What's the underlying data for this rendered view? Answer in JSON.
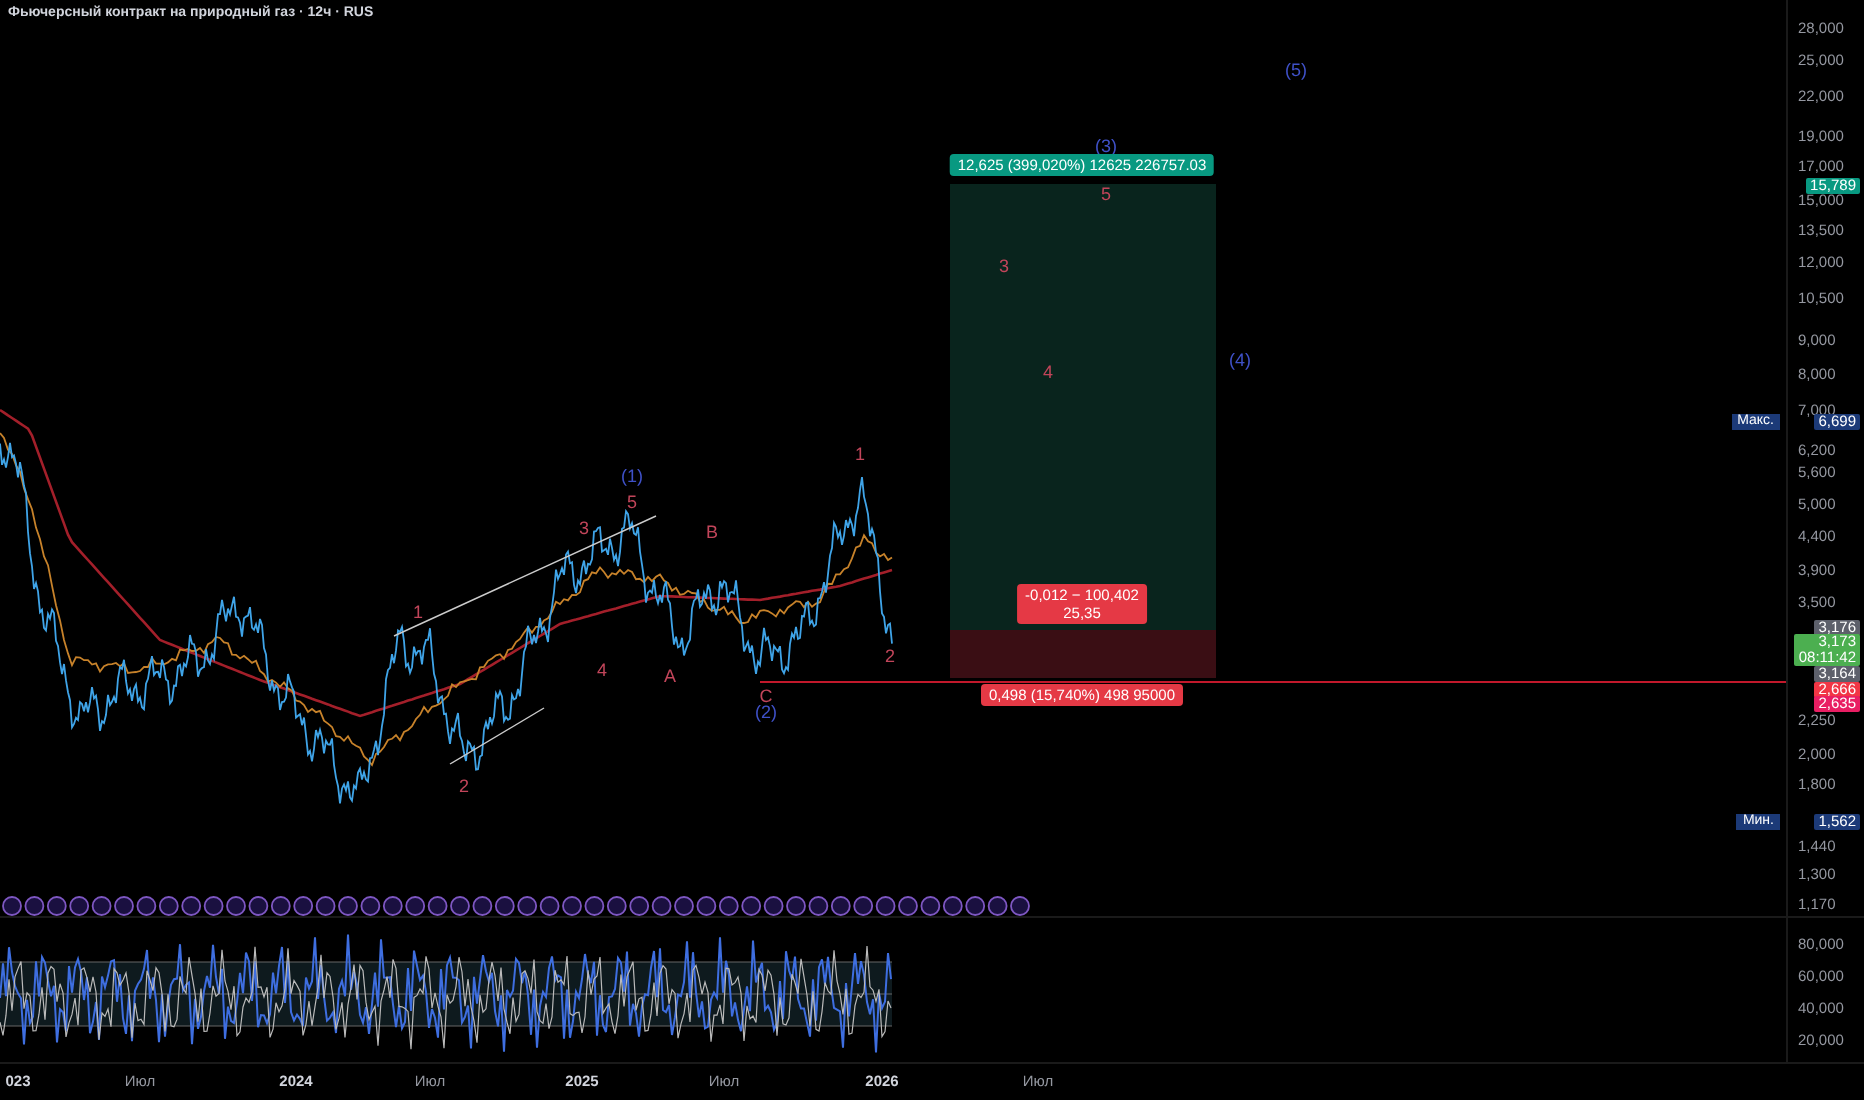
{
  "title": "Фьючерсный контракт на природный газ · 12ч · RUS",
  "wave_labels": [
    {
      "text": "(5)",
      "color": "#3f51c8"
    },
    {
      "text": "(3)",
      "color": "#3f51c8"
    },
    {
      "text": "5",
      "color": "#c2455a"
    },
    {
      "text": "3",
      "color": "#c2455a"
    },
    {
      "text": "4",
      "color": "#c2455a"
    },
    {
      "text": "(4)",
      "color": "#3f51c8"
    },
    {
      "text": "1",
      "color": "#c2455a"
    },
    {
      "text": "(1)",
      "color": "#3f51c8"
    },
    {
      "text": "5",
      "color": "#c2455a"
    },
    {
      "text": "3",
      "color": "#c2455a"
    },
    {
      "text": "B",
      "color": "#c2455a"
    },
    {
      "text": "1",
      "color": "#c2455a"
    },
    {
      "text": "4",
      "color": "#c2455a"
    },
    {
      "text": "A",
      "color": "#c2455a"
    },
    {
      "text": "2",
      "color": "#c2455a"
    },
    {
      "text": "C",
      "color": "#c2455a"
    },
    {
      "text": "(2)",
      "color": "#3f51c8"
    },
    {
      "text": "2",
      "color": "#c2455a"
    }
  ],
  "position": {
    "target_label": "12,625 (399,020%) 12625 226757.03",
    "center_lines": [
      "-0,012 − 100,402",
      "25,35"
    ],
    "stop_label": "0,498 (15,740%) 498 95000"
  },
  "price_axis": {
    "ticks": [
      "28,000",
      "25,000",
      "22,000",
      "19,000",
      "17,000",
      "15,000",
      "13,500",
      "12,000",
      "10,500",
      "9,000",
      "8,000",
      "7,000",
      "6,200",
      "5,600",
      "5,000",
      "4,400",
      "3,900",
      "3,500",
      "2,250",
      "2,000",
      "1,800",
      "1,440",
      "1,300",
      "1,170"
    ],
    "badges": [
      {
        "value": "15,789",
        "color": "#089981"
      },
      {
        "label": "Макс.",
        "value": "6,699",
        "color": "#1c3a78"
      },
      {
        "value": "3,176",
        "color": "#5d606b"
      },
      {
        "value": "3,173",
        "sub": "08:11:42",
        "color": "#4caf50"
      },
      {
        "value": "3,164",
        "color": "#5d606b"
      },
      {
        "value": "2,666",
        "color": "#f23645"
      },
      {
        "value": "2,635",
        "color": "#e91e63"
      },
      {
        "label": "Мин.",
        "value": "1,562",
        "color": "#1c3a78"
      }
    ]
  },
  "oscillator_axis": {
    "ticks": [
      "80,000",
      "60,000",
      "40,000",
      "20,000"
    ]
  },
  "time_axis": {
    "ticks": [
      {
        "text": "023",
        "kind": "year"
      },
      {
        "text": "Июл",
        "kind": "month"
      },
      {
        "text": "2024",
        "kind": "year"
      },
      {
        "text": "Июл",
        "kind": "month"
      },
      {
        "text": "2025",
        "kind": "year"
      },
      {
        "text": "Июл",
        "kind": "month"
      },
      {
        "text": "2026",
        "kind": "year"
      },
      {
        "text": "Июл",
        "kind": "month"
      }
    ]
  }
}
